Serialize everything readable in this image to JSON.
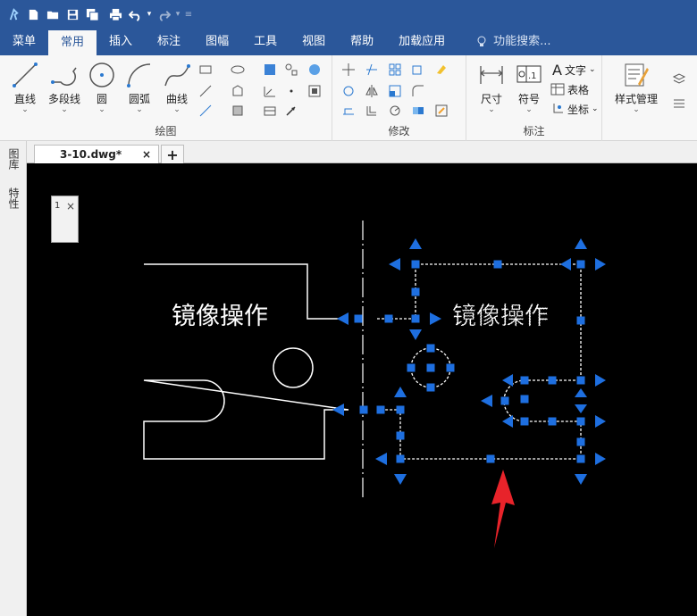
{
  "quick_access": {
    "icons": [
      "app-logo-icon",
      "new-file-icon",
      "open-folder-icon",
      "save-icon",
      "save-all-icon",
      "print-icon",
      "undo-icon",
      "redo-icon"
    ],
    "dropdown_glyph": "▾",
    "customize_glyph": "≡"
  },
  "menu": {
    "tabs": [
      "菜单",
      "常用",
      "插入",
      "标注",
      "图幅",
      "工具",
      "视图",
      "帮助",
      "加载应用"
    ],
    "active_tab": "常用",
    "search_placeholder": "功能搜索..."
  },
  "ribbon": {
    "draw_group": {
      "label": "绘图",
      "buttons": [
        "直线",
        "多段线",
        "圆",
        "圆弧",
        "曲线"
      ]
    },
    "modify_group": {
      "label": "修改"
    },
    "annotate_group": {
      "label": "标注",
      "buttons": [
        "尺寸",
        "符号"
      ],
      "small_buttons": [
        "文字",
        "表格",
        "坐标"
      ],
      "symbol_text": ".1"
    },
    "style_group": {
      "buttons": [
        "样式管理"
      ]
    }
  },
  "left_panel": {
    "tabs": [
      "图库",
      "特性"
    ]
  },
  "document": {
    "tab_title": "3-10.dwg*",
    "close_glyph": "×",
    "new_tab_glyph": "+"
  },
  "float_panel": {
    "close_glyph": "×",
    "label": "1"
  },
  "drawing": {
    "original_text": "镜像操作",
    "mirrored_text": "镜像操作",
    "line_color": "#ffffff",
    "grip_color": "#1e6fe0",
    "arrow_color": "#e8232a",
    "background": "#000000"
  },
  "colors": {
    "titlebar": "#2b579a",
    "ribbon_bg": "#f7f7f7"
  }
}
